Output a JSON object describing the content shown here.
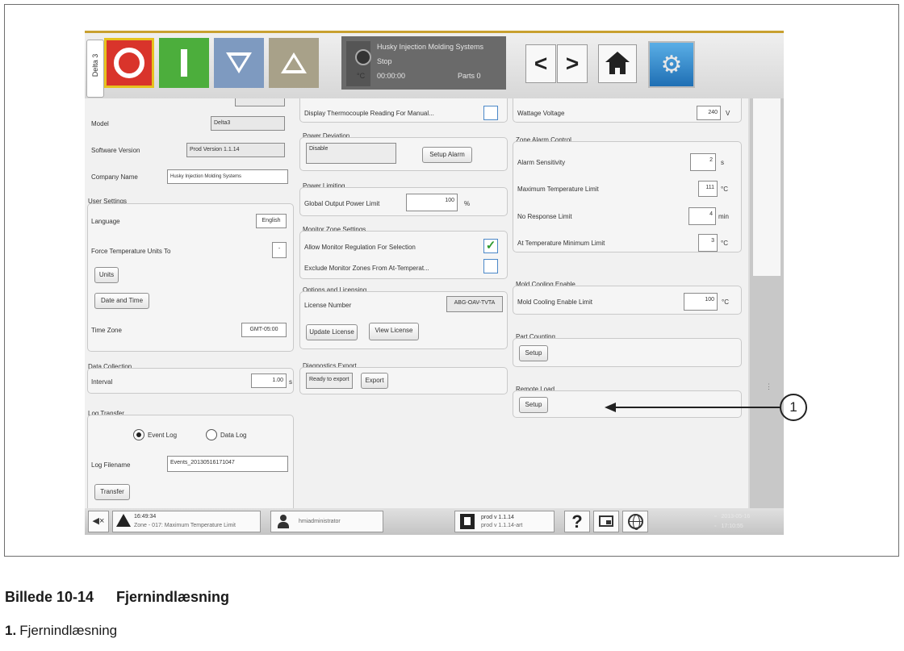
{
  "top_bar": {
    "machine_tab": "Delta 3",
    "status": {
      "company": "Husky Injection Molding Systems",
      "state": "Stop",
      "time": "00:00:00",
      "temp_unit": "°C",
      "parts": "Parts 0"
    },
    "back_glyph": "<",
    "forward_glyph": ">",
    "settings_glyph": "⚙"
  },
  "col1": {
    "model_label": "Model",
    "model_value": "Delta3",
    "software_label": "Software Version",
    "software_value": "Prod Version 1.1.14",
    "company_label": "Company Name",
    "company_value": "Husky Injection Molding Systems",
    "user_settings": {
      "title": "User Settings",
      "language_label": "Language",
      "language_value": "English",
      "force_temp_label": "Force Temperature Units To",
      "force_temp_value": "-",
      "units_button": "Units",
      "date_time_button": "Date and Time",
      "timezone_label": "Time Zone",
      "timezone_value": "GMT-05:00"
    },
    "data_collection": {
      "title": "Data Collection",
      "interval_label": "Interval",
      "interval_value": "1.00",
      "interval_unit": "s"
    },
    "log_transfer": {
      "title": "Log Transfer",
      "event_log": "Event Log",
      "data_log": "Data Log",
      "filename_label": "Log Filename",
      "filename_value": "Events_20130516171047",
      "transfer_button": "Transfer"
    }
  },
  "col2": {
    "display_tc_label": "Display Thermocouple Reading For Manual...",
    "power_deviation": {
      "title": "Power Deviation",
      "value": "Disable",
      "setup_alarm": "Setup Alarm"
    },
    "power_limiting": {
      "title": "Power Limiting",
      "label": "Global Output Power Limit",
      "value": "100",
      "unit": "%"
    },
    "monitor_zone": {
      "title": "Monitor Zone Settings",
      "allow_label": "Allow Monitor Regulation For Selection",
      "exclude_label": "Exclude Monitor Zones From At-Temperat..."
    },
    "options": {
      "title": "Options and Licensing",
      "license_label": "License Number",
      "license_value": "ABG-OAV-TVTA",
      "update_button": "Update License",
      "view_button": "View License"
    },
    "diagnostics": {
      "title": "Diagnostics Export",
      "status": "Ready to export",
      "export_button": "Export"
    }
  },
  "col3": {
    "wattage_label": "Wattage Voltage",
    "wattage_value": "240",
    "wattage_unit": "V",
    "zone_alarm": {
      "title": "Zone Alarm Control",
      "sensitivity_label": "Alarm Sensitivity",
      "sensitivity_value": "2",
      "sensitivity_unit": "s",
      "max_temp_label": "Maximum Temperature Limit",
      "max_temp_value": "111",
      "max_temp_unit": "°C",
      "no_response_label": "No Response Limit",
      "no_response_value": "4",
      "no_response_unit": "min",
      "at_temp_label": "At Temperature Minimum Limit",
      "at_temp_value": "3",
      "at_temp_unit": "°C"
    },
    "mold_cooling": {
      "title": "Mold Cooling Enable",
      "label": "Mold Cooling Enable Limit",
      "value": "100",
      "unit": "°C"
    },
    "part_counting": {
      "title": "Part Counting",
      "setup": "Setup"
    },
    "remote_load": {
      "title": "Remote Load",
      "setup": "Setup"
    }
  },
  "bottom_bar": {
    "mute_glyph": "◀×",
    "alarm_time": "16:49:34",
    "alarm_text": "Zone - 017: Maximum Temperature Limit",
    "user": "hmiadministrator",
    "version1": "prod v 1.1.14",
    "version2": "prod v 1.1.14-art",
    "help_glyph": "?",
    "date": "2013-05-16",
    "time": "17:10:55"
  },
  "callout_number": "1",
  "caption": {
    "figure": "Billede 10-14",
    "title": "Fjernindlæsning"
  },
  "legend": {
    "number": "1.",
    "text": "Fjernindlæsning"
  }
}
